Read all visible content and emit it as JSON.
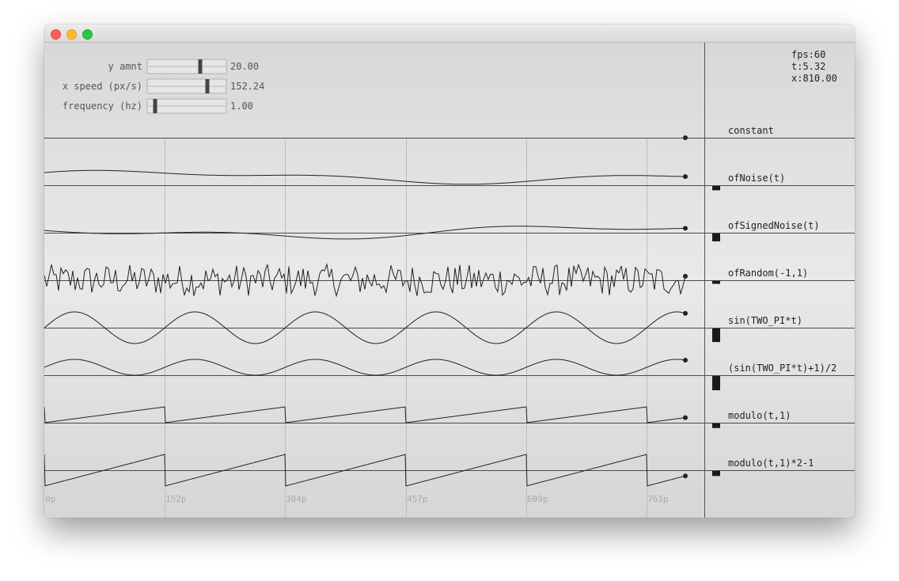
{
  "window": {
    "buttons": [
      "close",
      "minimize",
      "maximize"
    ]
  },
  "controls": [
    {
      "label": "y amnt",
      "value": "20.00",
      "fraction": 0.67
    },
    {
      "label": "x speed (px/s)",
      "value": "152.24",
      "fraction": 0.76
    },
    {
      "label": "frequency (hz)",
      "value": "1.00",
      "fraction": 0.1
    }
  ],
  "stats": {
    "fps": "fps:60",
    "t": "t:5.32",
    "x": "x:810.00"
  },
  "rows": [
    {
      "label": "constant",
      "bar": 0.0
    },
    {
      "label": "ofNoise(t)",
      "bar": 0.3
    },
    {
      "label": "ofSignedNoise(t)",
      "bar": 0.55
    },
    {
      "label": "ofRandom(-1,1)",
      "bar": 0.2
    },
    {
      "label": "sin(TWO_PI*t)",
      "bar": 0.95
    },
    {
      "label": "(sin(TWO_PI*t)+1)/2",
      "bar": 1.0
    },
    {
      "label": "modulo(t,1)",
      "bar": 0.32
    },
    {
      "label": "modulo(t,1)*2-1",
      "bar": 0.35
    }
  ],
  "xticks": [
    "0p",
    "152p",
    "304p",
    "457p",
    "609p",
    "761p"
  ],
  "colors": {
    "line": "#222222",
    "grid": "#bdbdbd",
    "tick": "#aaaaaa"
  }
}
